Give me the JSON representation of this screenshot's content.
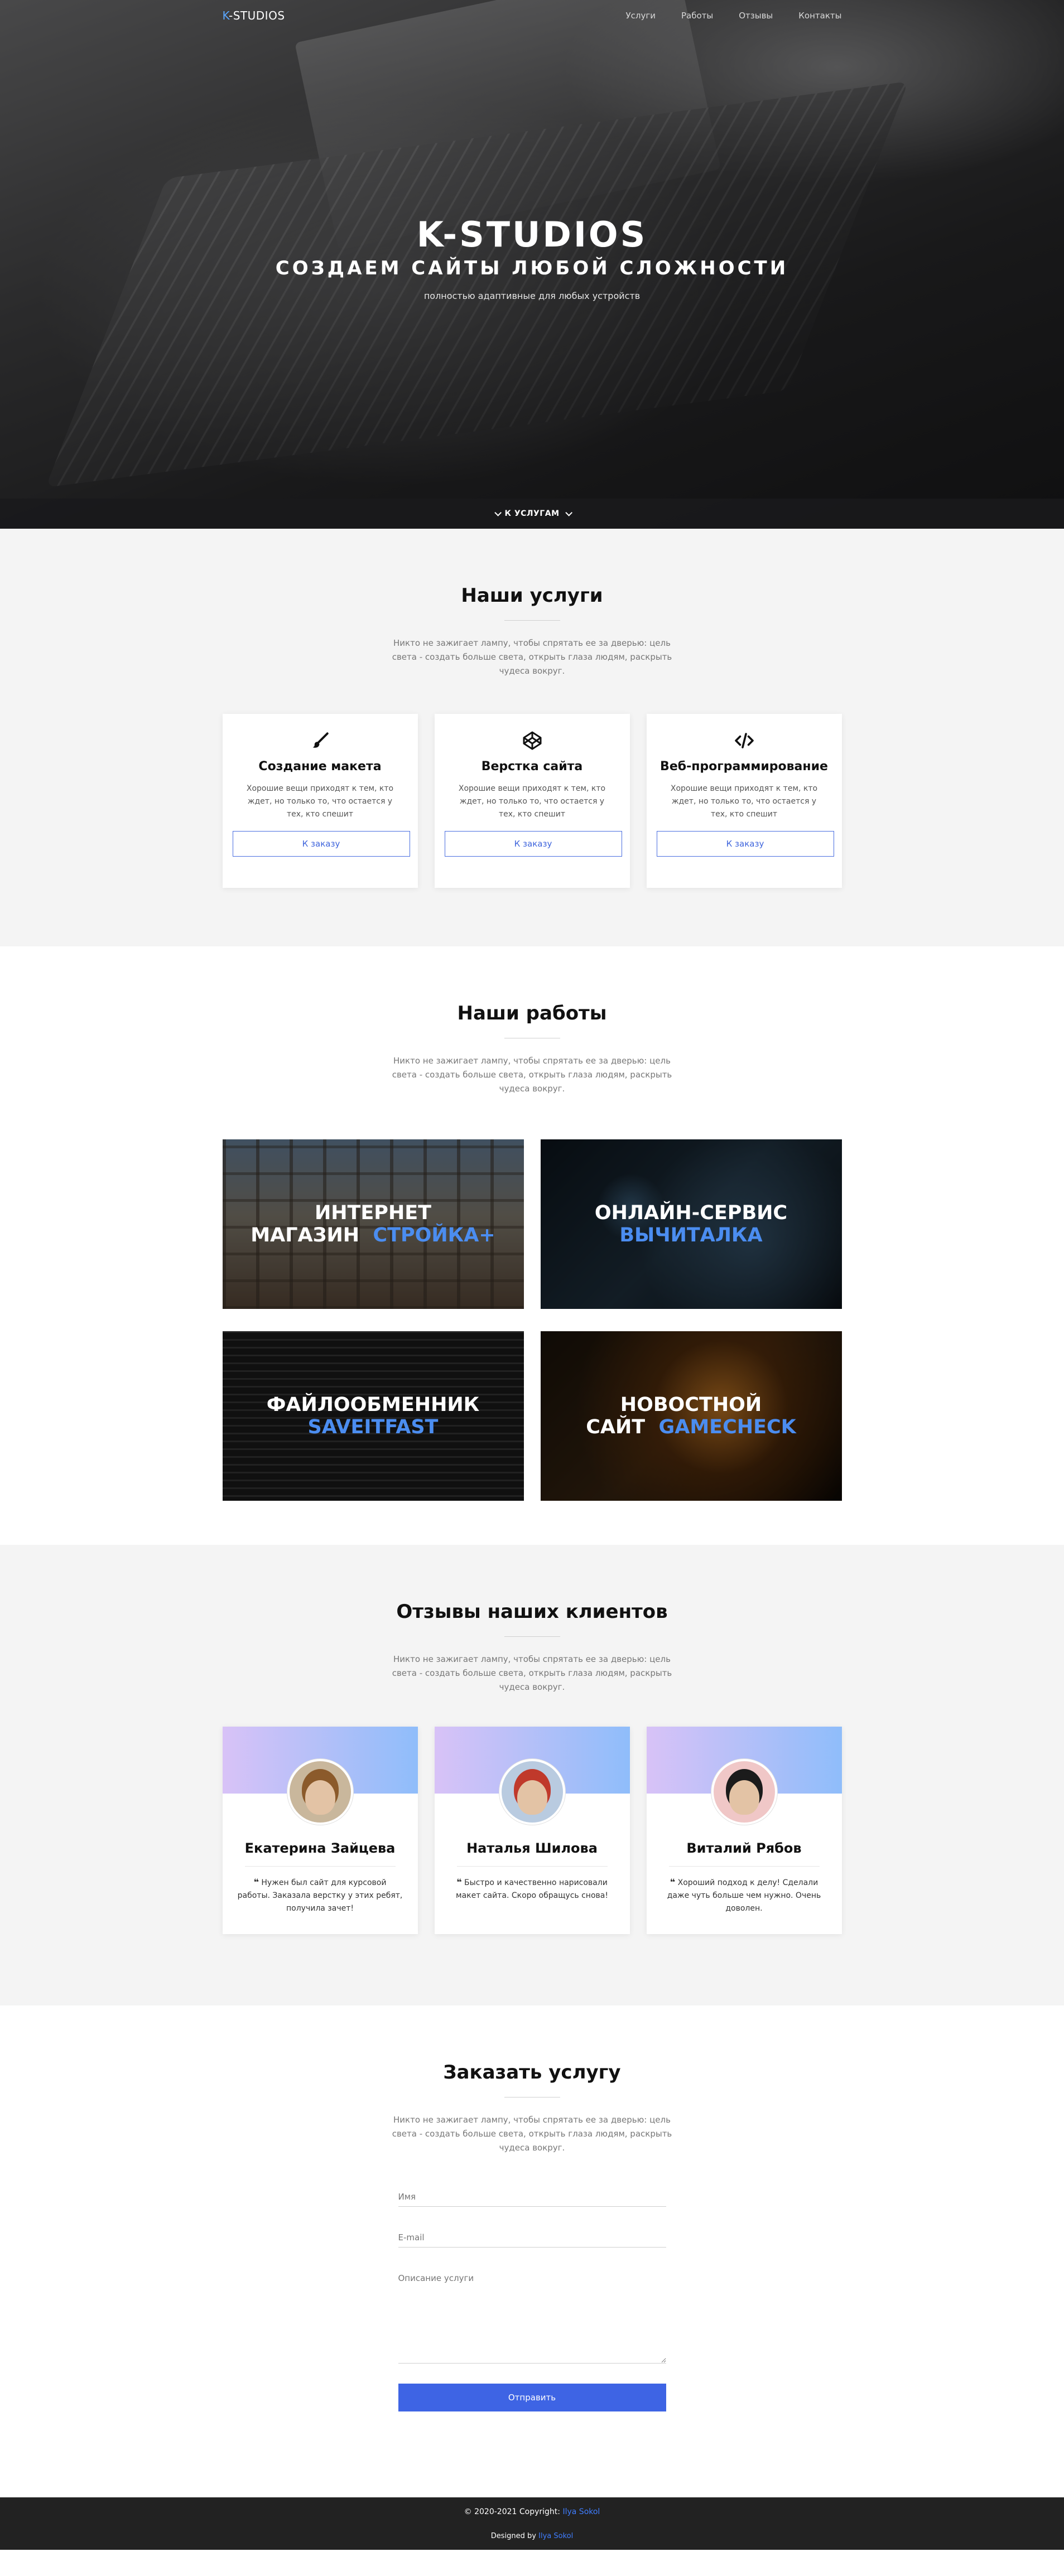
{
  "nav": {
    "logo_accent": "K",
    "logo_rest": "-STUDIOS",
    "links": [
      "Услуги",
      "Работы",
      "Отзывы",
      "Контакты"
    ]
  },
  "hero": {
    "title": "K-STUDIOS",
    "subtitle": "Создаем сайты любой сложности",
    "description": "полностью адаптивные для любых устройств",
    "scroll_label": "К УСЛУГАМ"
  },
  "common_desc": "Никто не зажигает лампу, чтобы спрятать ее за дверью: цель света - создать больше света, открыть глаза людям, раскрыть чудеса вокруг.",
  "services": {
    "title": "Наши услуги",
    "cards": [
      {
        "icon": "brush-icon",
        "title": "Создание макета",
        "text": "Хорошие вещи приходят к тем, кто ждет, но только то, что остается у тех, кто спешит",
        "button": "К заказу"
      },
      {
        "icon": "codepen-icon",
        "title": "Верстка сайта",
        "text": "Хорошие вещи приходят к тем, кто ждет, но только то, что остается у тех, кто спешит",
        "button": "К заказу"
      },
      {
        "icon": "code-icon",
        "title": "Веб-программирование",
        "text": "Хорошие вещи приходят к тем, кто ждет, но только то, что остается у тех, кто спешит",
        "button": "К заказу"
      }
    ]
  },
  "works": {
    "title": "Наши работы",
    "items": [
      {
        "line1": "Интернет",
        "line2a": "магазин",
        "highlight": "Стройка+"
      },
      {
        "line1": "Онлайн-сервис",
        "line2a": "",
        "highlight": "Вычиталка"
      },
      {
        "line1": "Файлообменник",
        "line2a": "",
        "highlight": "SaveItFast"
      },
      {
        "line1": "Новостной",
        "line2a": "сайт",
        "highlight": "GameCheck"
      }
    ]
  },
  "reviews": {
    "title": "Отзывы наших клиентов",
    "items": [
      {
        "name": "Екатерина Зайцева",
        "text": "Нужен был сайт для курсовой работы. Заказала верстку у этих ребят, получила зачет!"
      },
      {
        "name": "Наталья Шилова",
        "text": "Быстро и качественно нарисовали макет сайта. Скоро обращусь снова!"
      },
      {
        "name": "Виталий Рябов",
        "text": "Хороший подход к делу! Сделали даже чуть больше чем нужно. Очень доволен."
      }
    ]
  },
  "order": {
    "title": "Заказать услугу",
    "name_placeholder": "Имя",
    "email_placeholder": "E-mail",
    "desc_placeholder": "Описание услуги",
    "submit": "Отправить"
  },
  "footer": {
    "copyright": "© 2020-2021 Copyright: ",
    "author": "Ilya Sokol",
    "designed_by": "Designed by ",
    "designer": "Ilya Sokol"
  }
}
